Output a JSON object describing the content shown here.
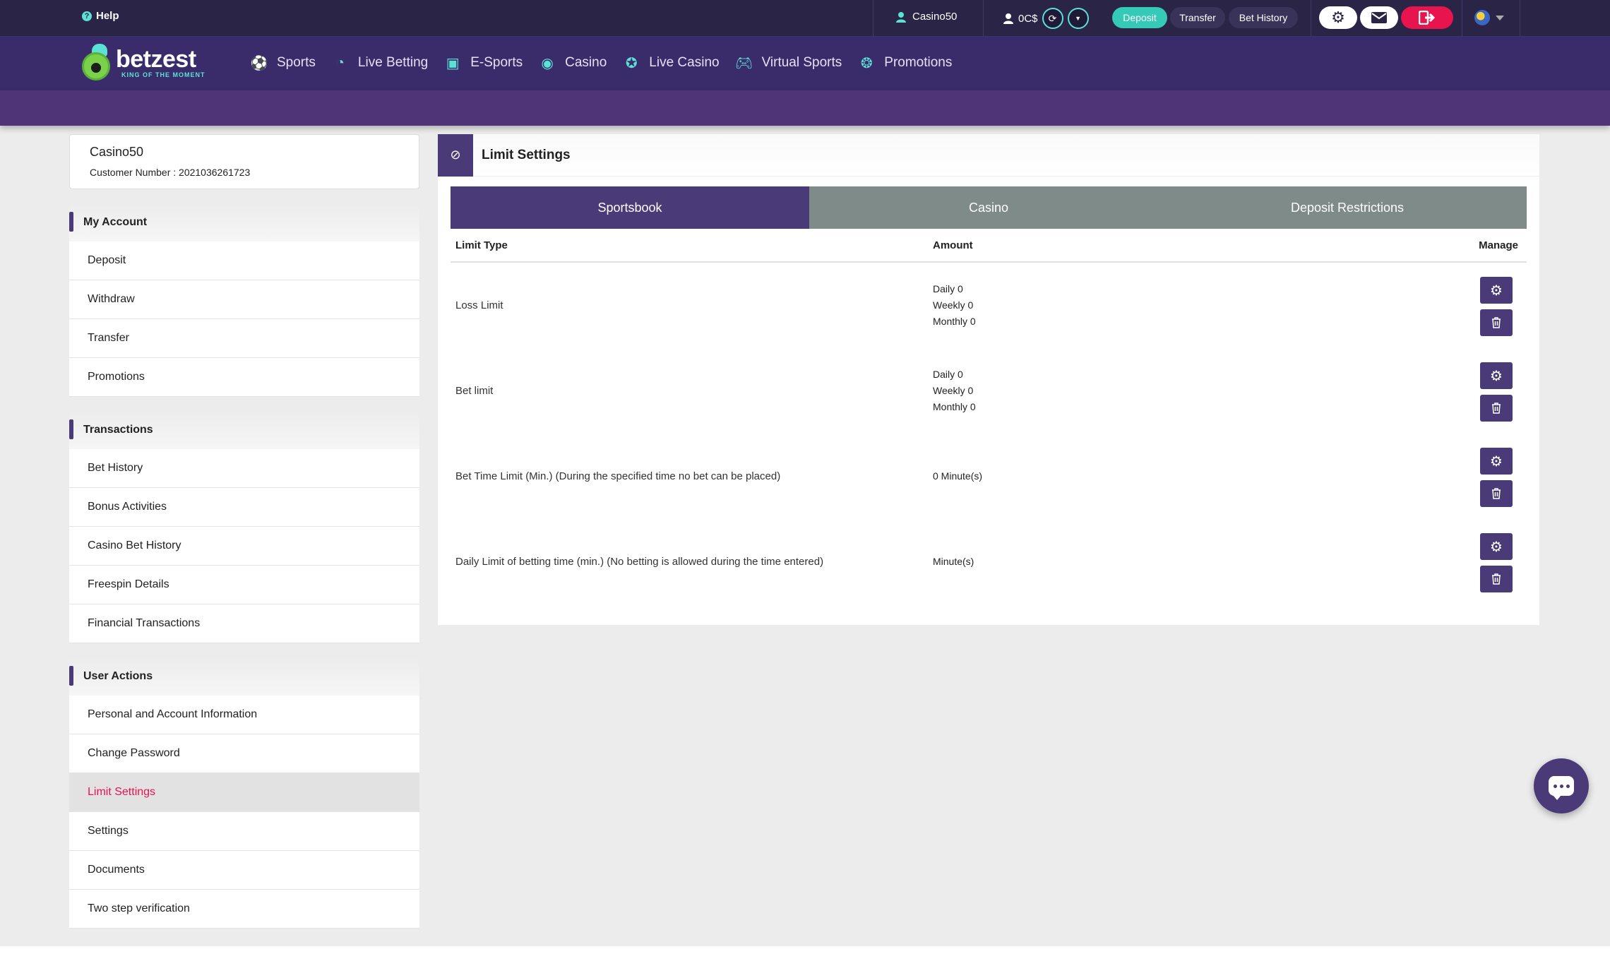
{
  "topbar": {
    "help_label": "Help",
    "username": "Casino50",
    "balance": "0C$",
    "deposit_label": "Deposit",
    "transfer_label": "Transfer",
    "bet_history_label": "Bet History"
  },
  "brand": {
    "name": "betzest",
    "tagline": "KING OF THE MOMENT",
    "accent_color": "#5ce1d6",
    "primary_color": "#4b3a78",
    "alert_color": "#e8144e"
  },
  "nav": [
    {
      "label": "Sports",
      "icon": "soccer-ball-icon"
    },
    {
      "label": "Live Betting",
      "icon": "stopwatch-icon"
    },
    {
      "label": "E-Sports",
      "icon": "esports-icon"
    },
    {
      "label": "Casino",
      "icon": "casino-chip-icon"
    },
    {
      "label": "Live Casino",
      "icon": "live-casino-icon"
    },
    {
      "label": "Virtual Sports",
      "icon": "gamepad-icon"
    },
    {
      "label": "Promotions",
      "icon": "promotions-icon"
    }
  ],
  "profile": {
    "name": "Casino50",
    "customer_number": "Customer Number : 2021036261723"
  },
  "sidebar": {
    "my_account": {
      "title": "My Account",
      "items": [
        "Deposit",
        "Withdraw",
        "Transfer",
        "Promotions"
      ]
    },
    "transactions": {
      "title": "Transactions",
      "items": [
        "Bet History",
        "Bonus Activities",
        "Casino Bet History",
        "Freespin Details",
        "Financial Transactions"
      ]
    },
    "user_actions": {
      "title": "User Actions",
      "items": [
        "Personal and Account Information",
        "Change Password",
        "Limit Settings",
        "Settings",
        "Documents",
        "Two step verification"
      ],
      "active": "Limit Settings"
    }
  },
  "panel": {
    "title": "Limit Settings",
    "tabs": [
      "Sportsbook",
      "Casino",
      "Deposit Restrictions"
    ],
    "active_tab": "Sportsbook",
    "columns": {
      "type": "Limit Type",
      "amount": "Amount",
      "manage": "Manage"
    },
    "rows": [
      {
        "type": "Loss Limit",
        "amounts": [
          "Daily 0",
          "Weekly 0",
          "Monthly 0"
        ]
      },
      {
        "type": "Bet limit",
        "amounts": [
          "Daily 0",
          "Weekly 0",
          "Monthly 0"
        ]
      },
      {
        "type": "Bet Time Limit (Min.) (During the specified time no bet can be placed)",
        "amounts": [
          "0 Minute(s)"
        ]
      },
      {
        "type": "Daily Limit of betting time (min.) (No betting is allowed during the time entered)",
        "amounts": [
          "Minute(s)"
        ]
      }
    ]
  }
}
